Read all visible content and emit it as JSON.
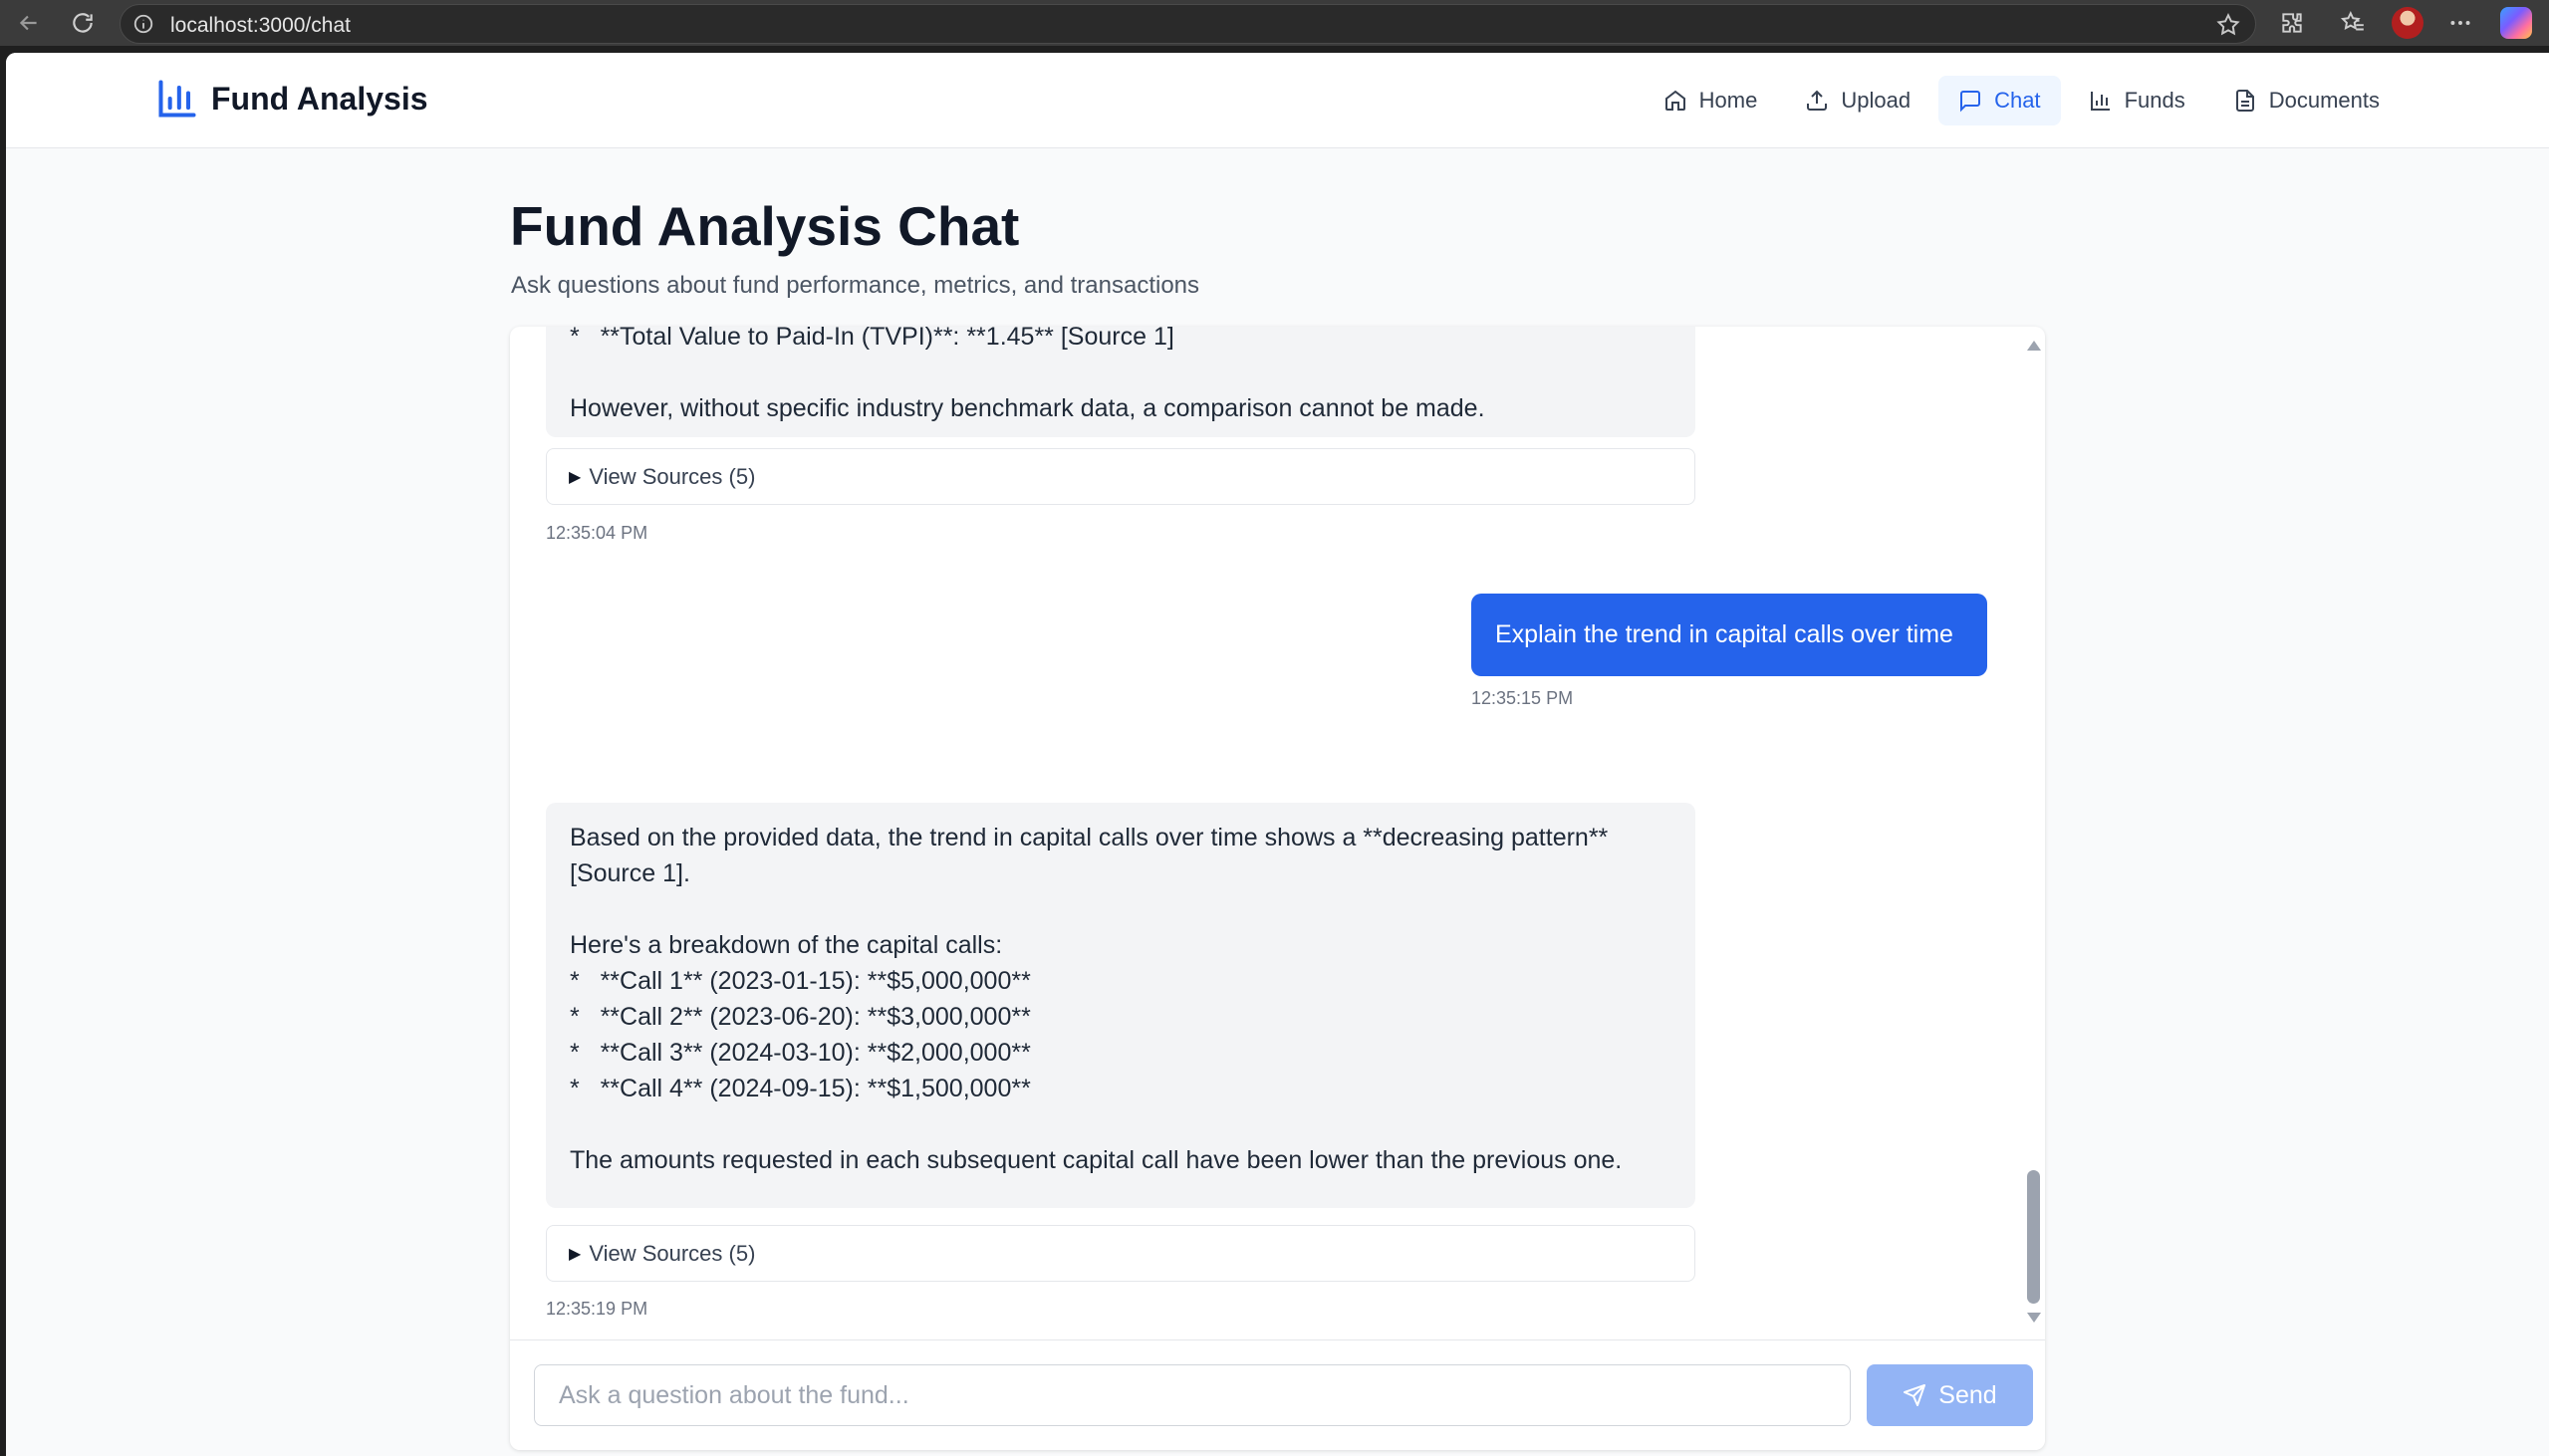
{
  "browser": {
    "url": "localhost:3000/chat"
  },
  "nav": {
    "brand": "Fund Analysis",
    "links": [
      {
        "label": "Home",
        "icon": "home-icon"
      },
      {
        "label": "Upload",
        "icon": "upload-icon"
      },
      {
        "label": "Chat",
        "icon": "chat-icon",
        "active": true
      },
      {
        "label": "Funds",
        "icon": "bar-chart-icon"
      },
      {
        "label": "Documents",
        "icon": "document-icon"
      }
    ]
  },
  "header": {
    "title": "Fund Analysis Chat",
    "subtitle": "Ask questions about fund performance, metrics, and transactions"
  },
  "messages": [
    {
      "role": "assistant",
      "text": "*   **Total Value to Paid-In (TVPI)**: **1.45** [Source 1]\n\nHowever, without specific industry benchmark data, a comparison cannot be made.",
      "sources_label": "View Sources (5)",
      "time": "12:35:04 PM"
    },
    {
      "role": "user",
      "text": "Explain the trend in capital calls over time",
      "time": "12:35:15 PM"
    },
    {
      "role": "assistant",
      "text": "Based on the provided data, the trend in capital calls over time shows a **decreasing pattern**\n[Source 1].\n\nHere's a breakdown of the capital calls:\n*   **Call 1** (2023-01-15): **$5,000,000**\n*   **Call 2** (2023-06-20): **$3,000,000**\n*   **Call 3** (2024-03-10): **$2,000,000**\n*   **Call 4** (2024-09-15): **$1,500,000**\n\nThe amounts requested in each subsequent capital call have been lower than the previous one.",
      "sources_label": "View Sources (5)",
      "time": "12:35:19 PM"
    }
  ],
  "composer": {
    "placeholder": "Ask a question about the fund...",
    "send_label": "Send"
  },
  "colors": {
    "accent": "#2563eb",
    "send_disabled": "#93b4f5",
    "assistant_bubble": "#f3f4f6"
  }
}
